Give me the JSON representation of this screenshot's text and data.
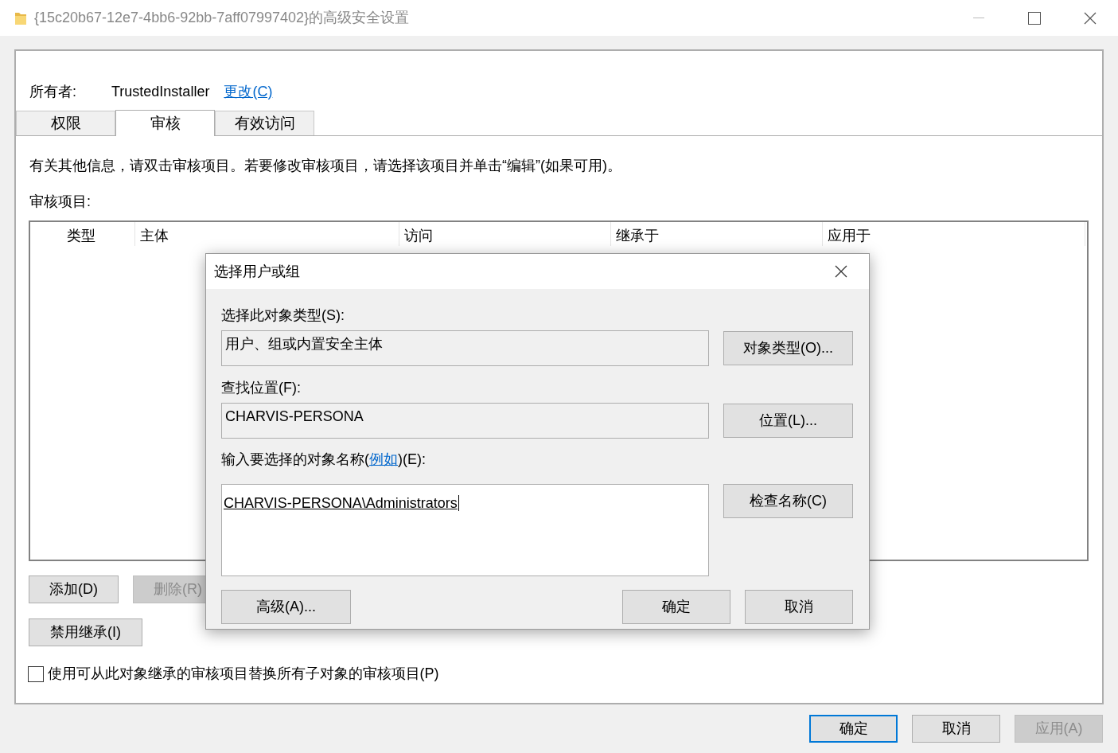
{
  "window": {
    "title": "{15c20b67-12e7-4bb6-92bb-7aff07997402}的高级安全设置"
  },
  "owner": {
    "label": "所有者:",
    "value": "TrustedInstaller",
    "link": "更改(C)"
  },
  "tabs": [
    {
      "label": "权限",
      "selected": false
    },
    {
      "label": "审核",
      "selected": true
    },
    {
      "label": "有效访问",
      "selected": false
    }
  ],
  "description": "有关其他信息，请双击审核项目。若要修改审核项目，请选择该项目并单击“编辑”(如果可用)。",
  "list_label": "审核项目:",
  "table": {
    "columns": [
      "类型",
      "主体",
      "访问",
      "继承于",
      "应用于"
    ]
  },
  "row_buttons": [
    {
      "label": "添加(D)",
      "disabled": false
    },
    {
      "label": "删除(R)",
      "disabled": true
    }
  ],
  "inherit_button": {
    "label": "禁用继承(I)"
  },
  "replace_checkbox": {
    "label": "使用可从此对象继承的审核项目替换所有子对象的审核项目(P)",
    "checked": false
  },
  "footer_buttons": [
    {
      "label": "确定",
      "default": true,
      "disabled": false
    },
    {
      "label": "取消",
      "default": false,
      "disabled": false
    },
    {
      "label": "应用(A)",
      "default": false,
      "disabled": true
    }
  ],
  "dialog": {
    "title": "选择用户或组",
    "object_type": {
      "label": "选择此对象类型(S):",
      "value": "用户、组或内置安全主体",
      "button": "对象类型(O)..."
    },
    "location": {
      "label": "查找位置(F):",
      "value": "CHARVIS-PERSONA",
      "button": "位置(L)..."
    },
    "names": {
      "label_before": "输入要选择的对象名称(",
      "link": "例如",
      "label_after": ")(E):",
      "value": "CHARVIS-PERSONA\\Administrators",
      "button": "检查名称(C)"
    },
    "buttons": [
      {
        "label": "高级(A)...",
        "kind": "left"
      },
      {
        "label": "确定",
        "kind": "right"
      },
      {
        "label": "取消",
        "kind": "right"
      }
    ]
  }
}
